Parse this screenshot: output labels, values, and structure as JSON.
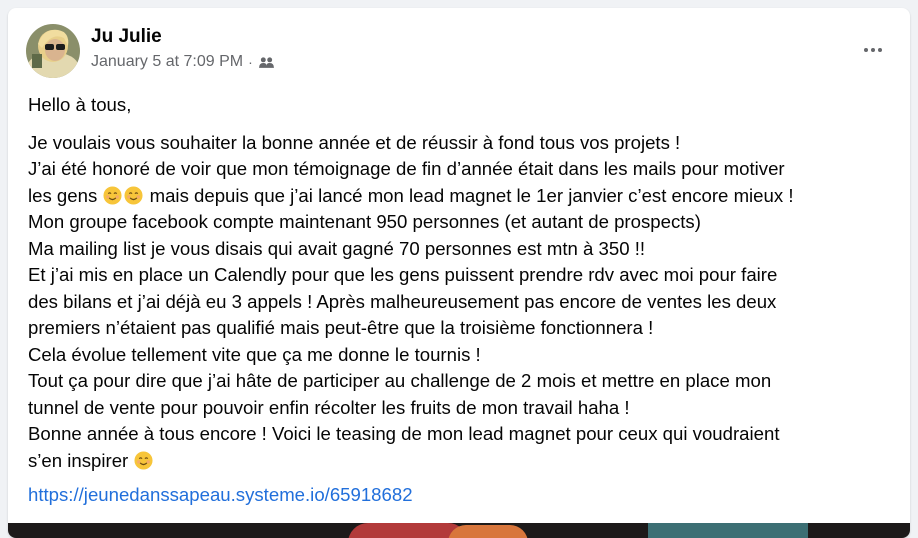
{
  "post": {
    "author": "Ju Julie",
    "timestamp": "January 5 at 7:09 PM",
    "separator": "·",
    "audience_icon": "friends-icon",
    "more_icon": "more-options-icon",
    "greeting": "Hello à tous,",
    "lines": [
      "Je voulais vous souhaiter la bonne année et de réussir à fond tous vos projets !",
      "J’ai été honoré de voir que mon témoignage de fin d’année était dans les mails pour motiver",
      "les gens",
      " mais depuis que j’ai lancé mon lead magnet le 1er janvier c’est encore mieux !",
      "Mon groupe facebook compte maintenant 950 personnes (et autant de prospects)",
      "Ma mailing list je vous disais qui avait gagné 70 personnes est mtn à 350 !!",
      "Et j’ai mis en place un Calendly pour que les gens puissent prendre rdv avec moi pour faire",
      "des bilans et j’ai déjà eu 3 appels ! Après malheureusement pas encore de ventes les deux",
      "premiers n’étaient pas qualifié mais peut-être que la troisième fonctionnera !",
      "Cela évolue tellement vite que ça me donne le tournis !",
      "Tout ça pour dire que j’ai hâte de participer au challenge de 2 mois et mettre en place mon",
      "tunnel de vente pour pouvoir enfin récolter les fruits de mon travail haha !",
      "Bonne année à tous encore ! Voici le teasing de mon lead magnet pour ceux qui voudraient",
      "s’en inspirer"
    ],
    "emoji_name": "smiling-face-emoji",
    "link": "https://jeunedanssapeau.systeme.io/65918682"
  },
  "colors": {
    "background": "#f0f2f5",
    "card": "#ffffff",
    "text": "#050505",
    "secondary": "#65676b",
    "link": "#216fdb"
  }
}
